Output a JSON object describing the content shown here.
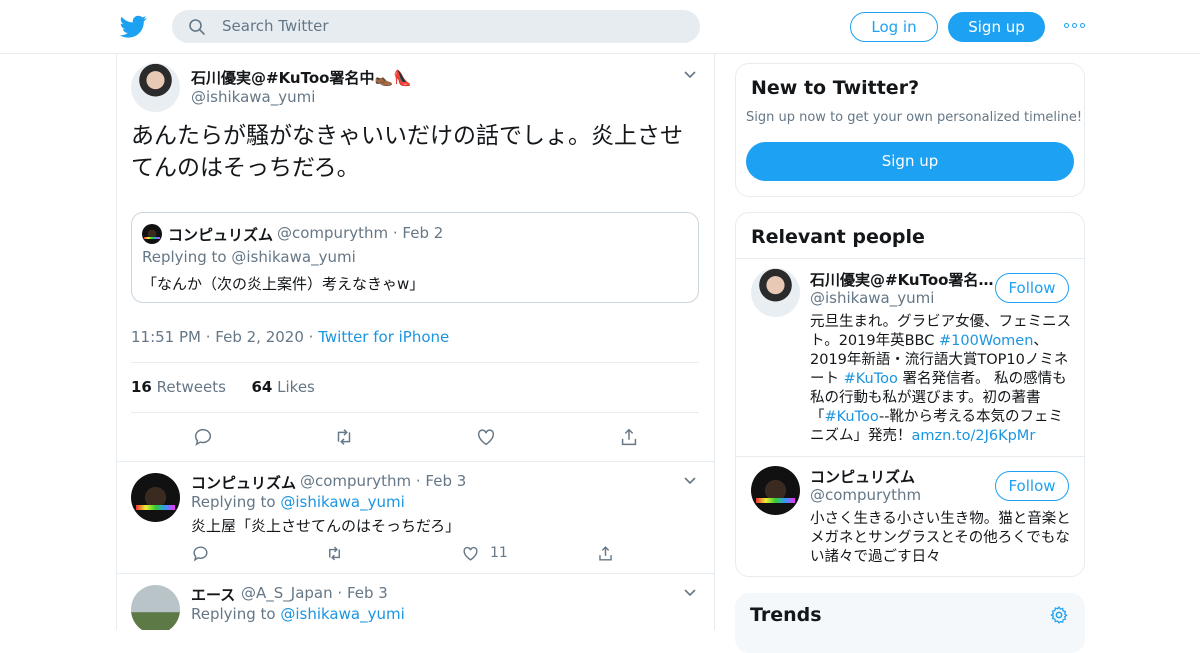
{
  "header": {
    "search_placeholder": "Search Twitter",
    "login_label": "Log in",
    "signup_label": "Sign up"
  },
  "tweet": {
    "name": "石川優実@#KuToo署名中👞👠",
    "handle": "@ishikawa_yumi",
    "text": "あんたらが騒がなきゃいいだけの話でしょ。炎上させてんのはそっちだろ。",
    "quote": {
      "name": "コンピュリズム",
      "handle": "@compurythm",
      "date": "Feb 2",
      "replying_prefix": "Replying to ",
      "replying_to": "@ishikawa_yumi",
      "text": "「なんか（次の炎上案件）考えなきゃw」"
    },
    "time": "11:51 PM",
    "date": "Feb 2, 2020",
    "source": "Twitter for iPhone",
    "retweets_count": "16",
    "retweets_label": "Retweets",
    "likes_count": "64",
    "likes_label": "Likes"
  },
  "replies": [
    {
      "name": "コンピュリズム",
      "handle": "@compurythm",
      "date": "Feb 3",
      "replying_prefix": "Replying to ",
      "replying_to": "@ishikawa_yumi",
      "text": "炎上屋「炎上させてんのはそっちだろ」",
      "likes": "11"
    },
    {
      "name": "エース",
      "handle": "@A_S_Japan",
      "date": "Feb 3",
      "replying_prefix": "Replying to ",
      "replying_to": "@ishikawa_yumi"
    }
  ],
  "sidebar": {
    "new_title": "New to Twitter?",
    "new_sub": "Sign up now to get your own personalized timeline!",
    "new_signup": "Sign up",
    "relevant_title": "Relevant people",
    "people": [
      {
        "name": "石川優実@#KuToo署名…",
        "handle": "@ishikawa_yumi",
        "follow": "Follow",
        "bio_1": "元旦生まれ。グラビア女優、フェミニスト。2019年英BBC ",
        "bio_tag_1": "#100Women",
        "bio_2": "、2019年新語・流行語大賞TOP10ノミネート ",
        "bio_tag_2": "#KuToo",
        "bio_3": " 署名発信者。 私の感情も私の行動も私が選びます。初の著書「",
        "bio_tag_3": "#KuToo",
        "bio_4": "--靴から考える本気のフェミニズム」発売！",
        "bio_link": "amzn.to/2J6KpMr"
      },
      {
        "name": "コンピュリズム",
        "handle": "@compurythm",
        "follow": "Follow",
        "bio": "小さく生きる小さい生き物。猫と音楽とメガネとサングラスとその他ろくでもない諸々で過ごす日々"
      }
    ],
    "trends_title": "Trends"
  }
}
